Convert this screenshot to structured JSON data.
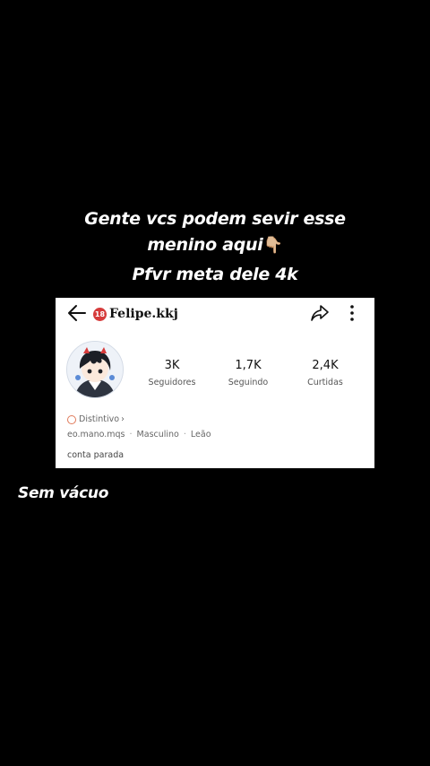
{
  "overlay": {
    "caption_line1": "Gente vcs podem sevir esse",
    "caption_line2": "menino aqui",
    "caption_emoji": "👇🏼",
    "caption_line3": "Pfvr meta dele 4k",
    "bottom_caption": "Sem vácuo"
  },
  "profile": {
    "badge": "18",
    "username": "Felipe.kkj",
    "stats": [
      {
        "value": "3K",
        "label": "Seguidores"
      },
      {
        "value": "1,7K",
        "label": "Seguindo"
      },
      {
        "value": "2,4K",
        "label": "Curtidas"
      }
    ],
    "distinctive_label": "Distintivo",
    "distinctive_arrow": "›",
    "info": {
      "handle": "eo.mano.mqs",
      "gender": "Masculino",
      "sign": "Leão"
    },
    "bio": "conta parada"
  },
  "colors": {
    "background": "#000000",
    "card": "#ffffff",
    "badge": "#d63b3b"
  },
  "icons": [
    "back-arrow-icon",
    "share-icon",
    "more-options-icon",
    "distinctive-icon"
  ]
}
